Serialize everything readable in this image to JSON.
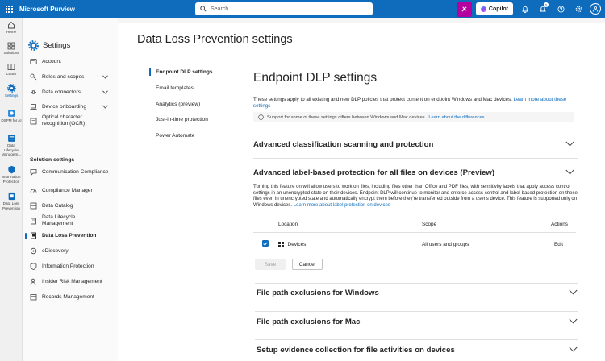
{
  "topbar": {
    "brand": "Microsoft Purview",
    "search_placeholder": "Search",
    "copilot_label": "Copilot",
    "notification_count": "1"
  },
  "rail": {
    "items": [
      {
        "label": "Home"
      },
      {
        "label": "Solutions"
      },
      {
        "label": "Learn"
      },
      {
        "label": "Settings"
      },
      {
        "label": "DSPM for AI"
      },
      {
        "label": "Data Lifecycle Managem..."
      },
      {
        "label": "Information Protection"
      },
      {
        "label": "Data Loss Prevention"
      }
    ]
  },
  "nav": {
    "title": "Settings",
    "items": [
      {
        "label": "Account"
      },
      {
        "label": "Roles and scopes"
      },
      {
        "label": "Data connectors"
      },
      {
        "label": "Device onboarding"
      },
      {
        "label": "Optical character recognition (OCR)"
      }
    ],
    "section_title": "Solution settings",
    "solution_items": [
      {
        "label": "Communication Compliance"
      },
      {
        "label": "Compliance Manager"
      },
      {
        "label": "Data Catalog"
      },
      {
        "label": "Data Lifecycle Management"
      },
      {
        "label": "Data Loss Prevention"
      },
      {
        "label": "eDiscovery"
      },
      {
        "label": "Information Protection"
      },
      {
        "label": "Insider Risk Management"
      },
      {
        "label": "Records Management"
      }
    ]
  },
  "main": {
    "page_title": "Data Loss Prevention settings",
    "subnav": [
      {
        "label": "Endpoint DLP settings"
      },
      {
        "label": "Email templates"
      },
      {
        "label": "Analytics (preview)"
      },
      {
        "label": "Just-in-time protection"
      },
      {
        "label": "Power Automate"
      }
    ]
  },
  "content": {
    "heading": "Endpoint DLP settings",
    "intro_text": "These settings apply to all existing and new DLP policies that protect content on endpoint Windows and Mac devices.",
    "intro_link": "Learn more about these settings",
    "info_text": "Support for some of these settings differs between Windows and Mac devices.",
    "info_link": "Learn about the differences",
    "sections": [
      {
        "title": "Advanced classification scanning and protection"
      },
      {
        "title": "Advanced label-based protection for all files on devices (Preview)"
      },
      {
        "title": "File path exclusions for Windows"
      },
      {
        "title": "File path exclusions for Mac"
      },
      {
        "title": "Setup evidence collection for file activities on devices"
      }
    ],
    "label_desc": "Turning this feature on will allow users to work on files, including files other than Office and PDF files, with sensitivity labels that apply access control settings in an unencrypted state on their devices. Endpoint DLP will continue to monitor and enforce access control and label-based protection on these files even in unencrypted state and automatically encrypt them before they're transferred outside from a user's device. This feature is supported only on Windows devices.",
    "label_link": "Learn more about label protection on devices",
    "table": {
      "headers": {
        "location": "Location",
        "scope": "Scope",
        "actions": "Actions"
      },
      "row": {
        "location": "Devices",
        "scope": "All users and groups",
        "action": "Edit"
      }
    },
    "save_label": "Save",
    "cancel_label": "Cancel"
  },
  "colors": {
    "accent": "#0f6cbd",
    "copilot_pink": "#b4009e"
  }
}
